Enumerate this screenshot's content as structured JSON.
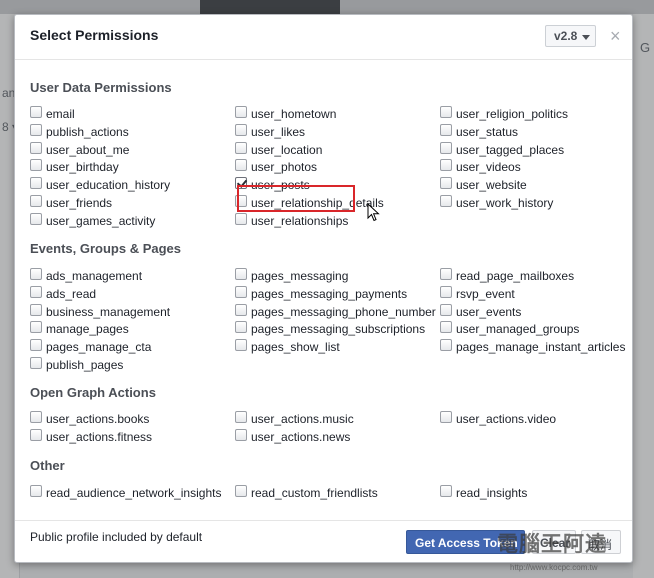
{
  "background": {
    "left_fragments": [
      "an",
      "8 ▾"
    ],
    "right_fragment": "G"
  },
  "dialog": {
    "title": "Select Permissions",
    "version": "v2.8",
    "close": "×"
  },
  "sections": [
    {
      "title": "User Data Permissions",
      "columns": [
        [
          "email",
          "publish_actions",
          "user_about_me",
          "user_birthday",
          "user_education_history",
          "user_friends",
          "user_games_activity"
        ],
        [
          "user_hometown",
          "user_likes",
          "user_location",
          "user_photos",
          "user_posts",
          "user_relationship_details",
          "user_relationships"
        ],
        [
          "user_religion_politics",
          "user_status",
          "user_tagged_places",
          "user_videos",
          "user_website",
          "user_work_history"
        ]
      ]
    },
    {
      "title": "Events, Groups & Pages",
      "columns": [
        [
          "ads_management",
          "ads_read",
          "business_management",
          "manage_pages",
          "pages_manage_cta",
          "publish_pages"
        ],
        [
          "pages_messaging",
          "pages_messaging_payments",
          "pages_messaging_phone_number",
          "pages_messaging_subscriptions",
          "pages_show_list"
        ],
        [
          "read_page_mailboxes",
          "rsvp_event",
          "user_events",
          "user_managed_groups",
          "pages_manage_instant_articles"
        ]
      ]
    },
    {
      "title": "Open Graph Actions",
      "columns": [
        [
          "user_actions.books",
          "user_actions.fitness"
        ],
        [
          "user_actions.music",
          "user_actions.news"
        ],
        [
          "user_actions.video"
        ]
      ]
    },
    {
      "title": "Other",
      "columns": [
        [
          "read_audience_network_insights"
        ],
        [
          "read_custom_friendlists"
        ],
        [
          "read_insights"
        ]
      ]
    }
  ],
  "checked": [
    "user_posts"
  ],
  "footer": {
    "note": "Public profile included by default",
    "get_token": "Get Access Token",
    "clear": "Clear",
    "cancel": "取消"
  },
  "watermark": {
    "text": "電腦王阿達",
    "url": "http://www.kocpc.com.tw"
  },
  "colors": {
    "primary": "#4267b2",
    "highlight": "#d9262a"
  }
}
